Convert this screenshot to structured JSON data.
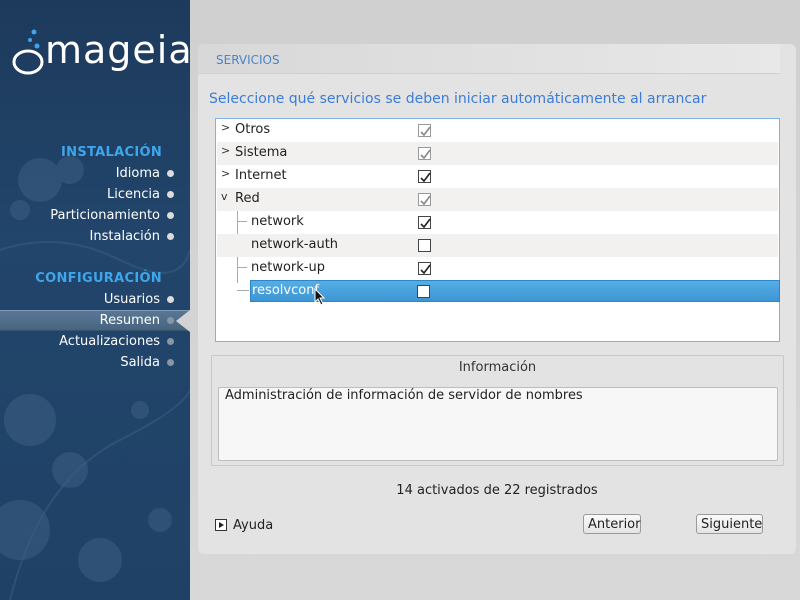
{
  "sidebar": {
    "brand": "mageia",
    "sections": [
      {
        "heading": "INSTALACIÓN",
        "items": [
          {
            "label": "Idioma",
            "state": "done"
          },
          {
            "label": "Licencia",
            "state": "done"
          },
          {
            "label": "Particionamiento",
            "state": "done"
          },
          {
            "label": "Instalación",
            "state": "done"
          }
        ]
      },
      {
        "heading": "CONFIGURACIÓN",
        "items": [
          {
            "label": "Usuarios",
            "state": "done"
          },
          {
            "label": "Resumen",
            "state": "active"
          },
          {
            "label": "Actualizaciones",
            "state": "pending"
          },
          {
            "label": "Salida",
            "state": "pending"
          }
        ]
      }
    ]
  },
  "page": {
    "section_title": "SERVICIOS",
    "instruction": "Seleccione qué servicios se deben iniciar automáticamente al arrancar"
  },
  "tree": {
    "rows": [
      {
        "label": "Otros",
        "expander": ">",
        "checked": true,
        "greyed": true
      },
      {
        "label": "Sistema",
        "expander": ">",
        "checked": true,
        "greyed": true
      },
      {
        "label": "Internet",
        "expander": ">",
        "checked": true,
        "greyed": false
      },
      {
        "label": "Red",
        "expander": "v",
        "checked": true,
        "greyed": true
      },
      {
        "label": "network",
        "expander": "",
        "checked": true,
        "greyed": false
      },
      {
        "label": "network-auth",
        "expander": "",
        "checked": false,
        "greyed": false
      },
      {
        "label": "network-up",
        "expander": "",
        "checked": true,
        "greyed": false
      },
      {
        "label": "resolvconf",
        "expander": "",
        "checked": false,
        "greyed": false,
        "selected": true
      }
    ]
  },
  "info": {
    "title": "Información",
    "text": "Administración de información de servidor de nombres"
  },
  "status": "14 activados de 22 registrados",
  "buttons": {
    "help": "Ayuda",
    "previous": "Anterior",
    "next": "Siguiente"
  },
  "colors": {
    "sidebar_bg": "#1f4166",
    "accent": "#3ea6ea",
    "selection": "#4aa3df"
  }
}
